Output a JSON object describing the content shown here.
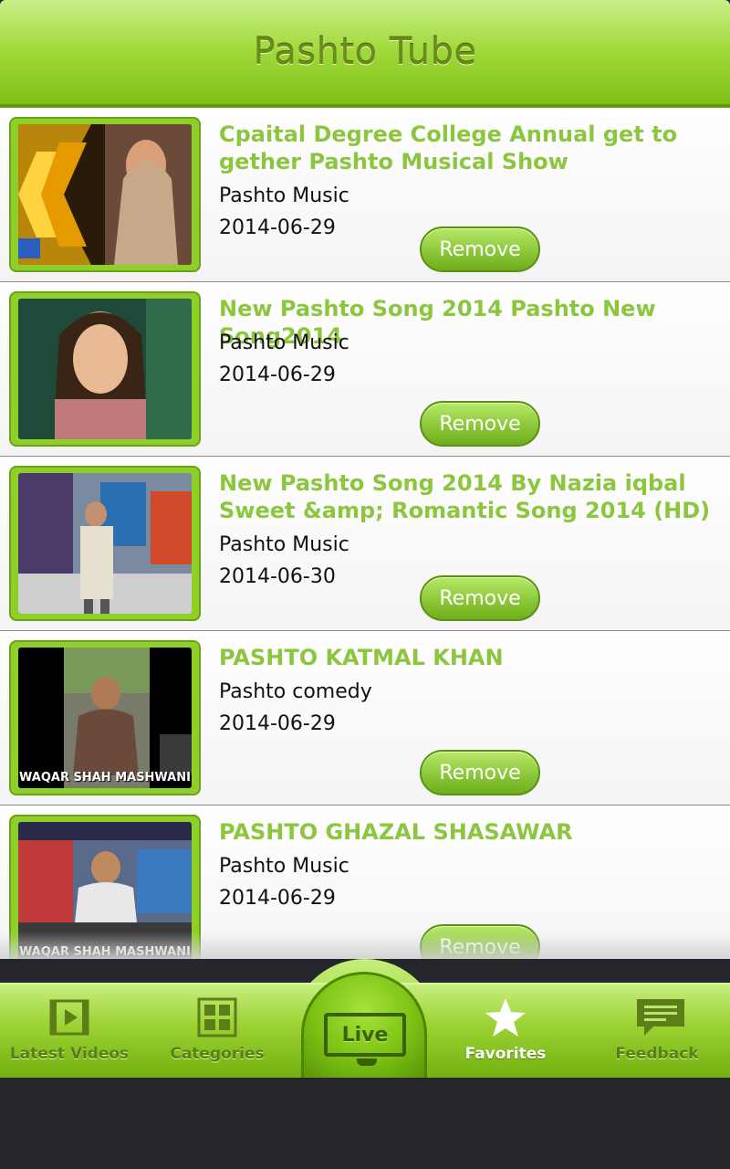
{
  "header": {
    "title": "Pashto Tube"
  },
  "videos": [
    {
      "title": "Cpaital Degree College Annual get to gether Pashto Musical Show",
      "category": "Pashto Music",
      "date": "2014-06-29",
      "remove_label": "Remove",
      "thumb_text": ""
    },
    {
      "title": "New Pashto Song 2014 Pashto New Song2014",
      "category": "Pashto Music",
      "date": "2014-06-29",
      "remove_label": "Remove",
      "thumb_text": ""
    },
    {
      "title": "New Pashto Song 2014 By Nazia iqbal Sweet &amp; Romantic Song 2014 (HD)",
      "category": "Pashto Music",
      "date": "2014-06-30",
      "remove_label": "Remove",
      "thumb_text": ""
    },
    {
      "title": "PASHTO KATMAL KHAN",
      "category": "Pashto comedy",
      "date": "2014-06-29",
      "remove_label": "Remove",
      "thumb_text": "WAQAR SHAH MASHWANI"
    },
    {
      "title": "PASHTO GHAZAL SHASAWAR",
      "category": "Pashto Music",
      "date": "2014-06-29",
      "remove_label": "Remove",
      "thumb_text": "WAQAR SHAH MASHWANI"
    }
  ],
  "tabbar": {
    "latest": "Latest Videos",
    "categories": "Categories",
    "live": "Live",
    "favorites": "Favorites",
    "feedback": "Feedback",
    "active": "favorites"
  },
  "colors": {
    "accent": "#8cc63f",
    "bar_green": "#9ad232",
    "active_tab": "#ffffff"
  }
}
